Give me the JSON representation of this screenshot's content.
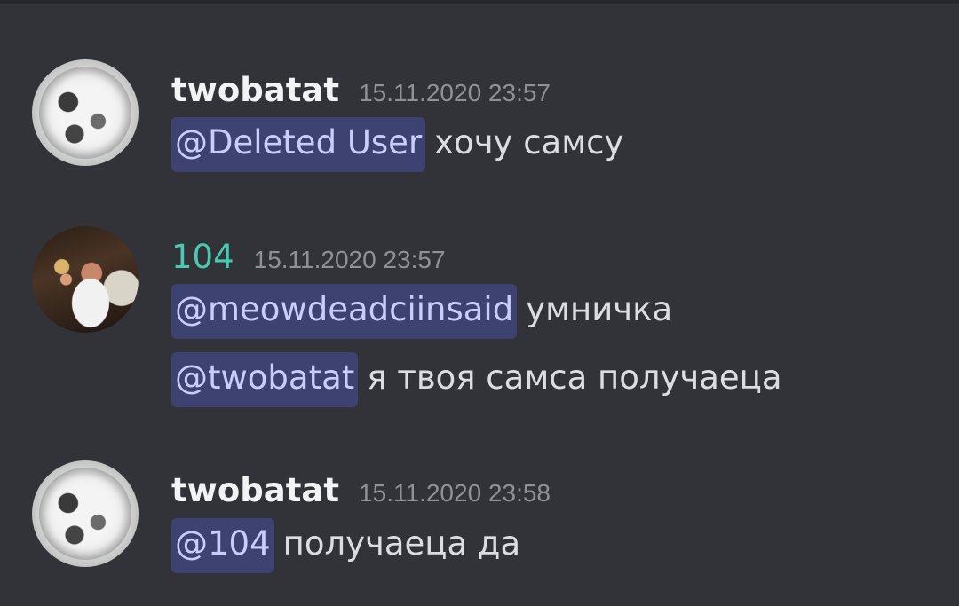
{
  "messages": [
    {
      "author": "twobatat",
      "timestamp": "15.11.2020 23:57",
      "avatar": "white-orb-avatar",
      "lines": [
        {
          "mention": "@Deleted User",
          "text": "хочу самсу"
        }
      ]
    },
    {
      "author": "104",
      "timestamp": "15.11.2020 23:57",
      "author_color": "#48c9b0",
      "avatar": "photo-avatar",
      "lines": [
        {
          "mention": "@meowdeadciinsaid",
          "text": "умничка"
        },
        {
          "mention": "@twobatat",
          "text": "я твоя самса получаеца"
        }
      ]
    },
    {
      "author": "twobatat",
      "timestamp": "15.11.2020 23:58",
      "avatar": "white-orb-avatar",
      "lines": [
        {
          "mention": "@104",
          "text": "получаеца да"
        }
      ]
    }
  ],
  "colors": {
    "background": "#313338",
    "mention_bg": "#3d4270",
    "mention_text": "#c9cdfb",
    "timestamp": "#8e9297"
  }
}
